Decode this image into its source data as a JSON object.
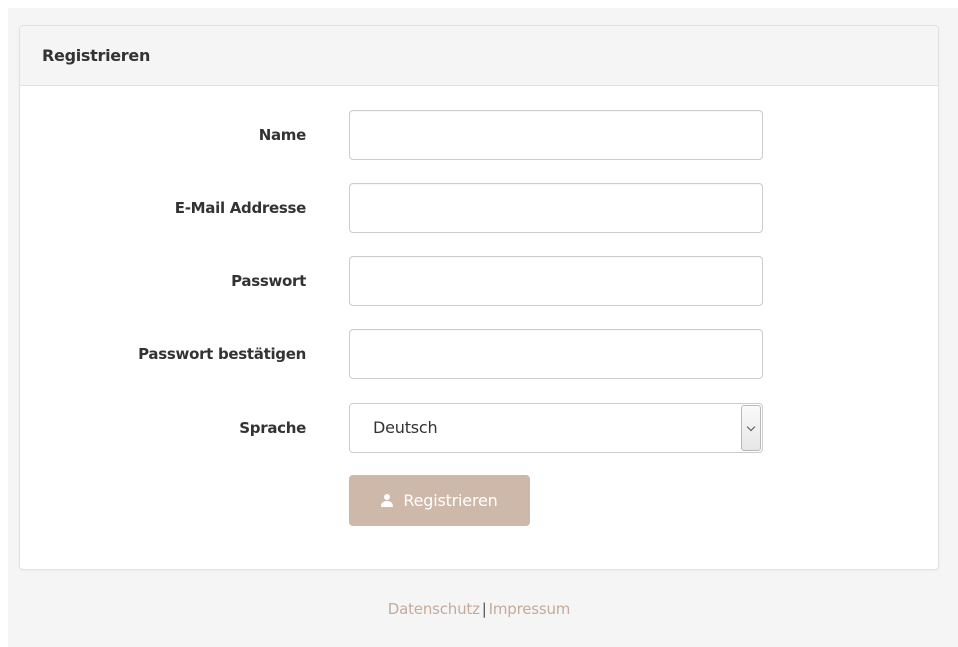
{
  "panel": {
    "title": "Registrieren"
  },
  "form": {
    "name": {
      "label": "Name",
      "value": ""
    },
    "email": {
      "label": "E-Mail Addresse",
      "value": ""
    },
    "password": {
      "label": "Passwort",
      "value": ""
    },
    "password_confirm": {
      "label": "Passwort bestätigen",
      "value": ""
    },
    "language": {
      "label": "Sprache",
      "selected": "Deutsch"
    },
    "submit": {
      "label": "Registrieren",
      "icon": "user-icon"
    }
  },
  "footer": {
    "privacy": "Datenschutz",
    "separator": "|",
    "imprint": "Impressum"
  },
  "colors": {
    "accent": "#c4ab9a",
    "button_bg": "#cdb8aa",
    "panel_heading_bg": "#f5f5f5"
  }
}
